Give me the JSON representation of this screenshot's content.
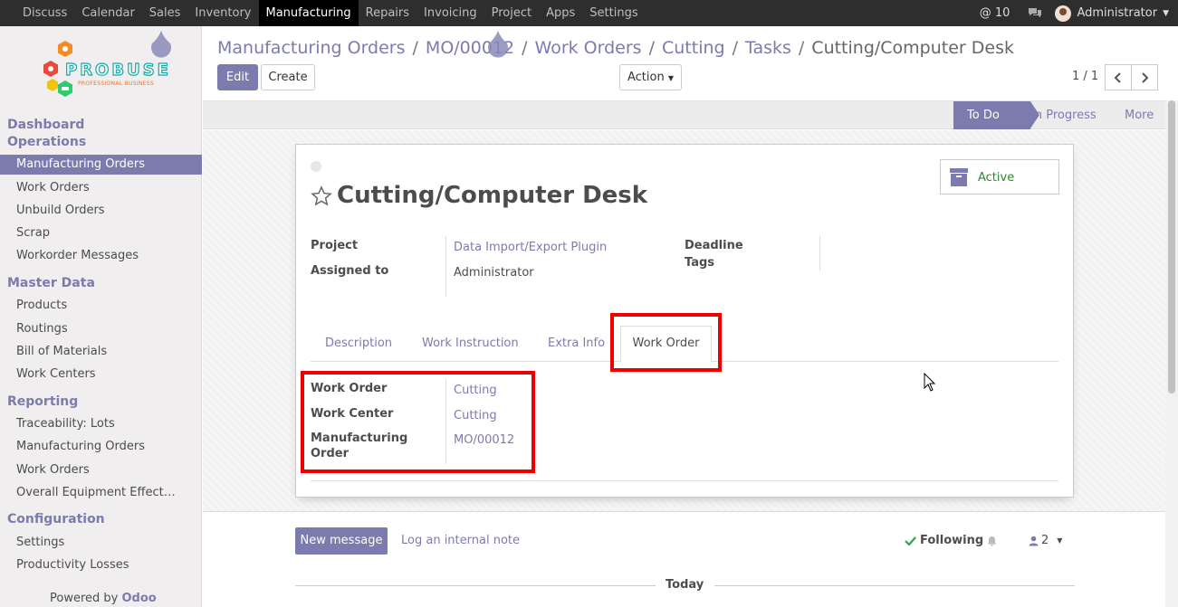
{
  "topbar": {
    "menu": [
      "Discuss",
      "Calendar",
      "Sales",
      "Inventory",
      "Manufacturing",
      "Repairs",
      "Invoicing",
      "Project",
      "Apps",
      "Settings"
    ],
    "active_menu": "Manufacturing",
    "mention_count": "@ 10",
    "user": "Administrator"
  },
  "logo": {
    "text": "PROBUSE",
    "subtitle": "PROFESSIONAL BUSINESS"
  },
  "sidebar": {
    "sections": [
      {
        "title": "Dashboard",
        "items": []
      },
      {
        "title": "Operations",
        "items": [
          "Manufacturing Orders",
          "Work Orders",
          "Unbuild Orders",
          "Scrap",
          "Workorder Messages"
        ]
      },
      {
        "title": "Master Data",
        "items": [
          "Products",
          "Routings",
          "Bill of Materials",
          "Work Centers"
        ]
      },
      {
        "title": "Reporting",
        "items": [
          "Traceability: Lots",
          "Manufacturing Orders",
          "Work Orders",
          "Overall Equipment Effect…"
        ]
      },
      {
        "title": "Configuration",
        "items": [
          "Settings",
          "Productivity Losses"
        ]
      }
    ],
    "active_item": "Manufacturing Orders",
    "powered_by": "Powered by",
    "powered_brand": "Odoo"
  },
  "breadcrumb": {
    "items": [
      "Manufacturing Orders",
      "MO/00012",
      "Work Orders",
      "Cutting",
      "Tasks"
    ],
    "current": "Cutting/Computer Desk",
    "separator": "/"
  },
  "buttons": {
    "edit": "Edit",
    "create": "Create",
    "action": "Action"
  },
  "pager": {
    "value": "1 / 1"
  },
  "statusbar": {
    "stages": [
      "To Do",
      "In Progress",
      "More"
    ],
    "current": "To Do"
  },
  "record": {
    "title": "Cutting/Computer Desk",
    "active_label": "Active",
    "fields": {
      "project_label": "Project",
      "project_value": "Data Import/Export Plugin",
      "assigned_label": "Assigned to",
      "assigned_value": "Administrator",
      "deadline_label": "Deadline",
      "tags_label": "Tags"
    },
    "tabs": [
      "Description",
      "Work Instruction",
      "Extra Info",
      "Work Order"
    ],
    "active_tab": "Work Order",
    "work_order_tab": {
      "work_order_label": "Work Order",
      "work_order_value": "Cutting",
      "work_center_label": "Work Center",
      "work_center_value": "Cutting",
      "manufacturing_order_label": "Manufacturing Order",
      "manufacturing_order_value": "MO/00012"
    }
  },
  "chatter": {
    "new_message": "New message",
    "log_note": "Log an internal note",
    "following": "Following",
    "followers_count": "2",
    "today": "Today"
  },
  "colors": {
    "accent": "#7c7bad",
    "highlight_box": "#ee0000",
    "topbar": "#2e2e2e"
  }
}
